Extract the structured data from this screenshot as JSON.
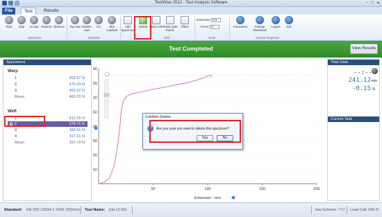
{
  "window": {
    "title": "TestWise 2012 - Test Analysis Software",
    "controls": [
      "–",
      "□",
      "✕"
    ]
  },
  "ribbon": {
    "tabs": [
      "File",
      "Test",
      "Results"
    ],
    "buttons": {
      "start": "Start",
      "stop": "Stop",
      "accept": "Accept",
      "restore": "Restore",
      "observe": "Observe",
      "top_jaw": "Top Jaw",
      "bottom_jaw": "Bottom Jaw",
      "go": "Go",
      "tare_loadcell": "Tare Loadcell",
      "add_specimen": "Add Specimen",
      "delete": "Delete",
      "select_all": "Select All+",
      "show_data_points": "Show Data Points",
      "offset": "Offset",
      "favourites": "Favourites",
      "change_password": "Change Password",
      "logout": "Logout",
      "exit": "Exit"
    },
    "fields": {
      "extension_label": "Extension",
      "extension_unit": "mm",
      "force_label": "Force",
      "force_unit": "N"
    },
    "groups": {
      "specimen": "Specimen",
      "machine": "Machine",
      "edit": "Edit",
      "units": "Units",
      "service_engineer": "Service Engineer"
    }
  },
  "banner": {
    "message": "Test Completed",
    "view_results": "View Results"
  },
  "specimens": {
    "header": "Specimens",
    "warp": {
      "label": "Warp",
      "rows": [
        {
          "n": "1",
          "v": "452.57 N"
        },
        {
          "n": "2",
          "v": "472.33 N"
        },
        {
          "n": "3",
          "v": "463.22 N"
        }
      ],
      "mean": {
        "n": "Mean",
        "v": "462.70 N"
      }
    },
    "weft": {
      "label": "Weft",
      "rows": [
        {
          "n": "1",
          "v": "412.25 N"
        },
        {
          "n": "2",
          "v": "378.71 N"
        },
        {
          "n": "3",
          "v": "382.51 N"
        },
        {
          "n": "4",
          "v": "417.31 N"
        }
      ],
      "mean": {
        "n": "Mean",
        "v": "397.70 N"
      }
    }
  },
  "chart_data": {
    "type": "line",
    "xlabel": "Extension - mm",
    "ylabel": "Force - N",
    "xlim": [
      0,
      200
    ],
    "ylim": [
      0,
      400
    ],
    "xticks": [
      50,
      100,
      150,
      200
    ],
    "yticks": [
      50,
      100,
      150,
      200,
      250,
      300,
      350,
      400
    ],
    "series": [
      {
        "x": [
          0,
          5,
          10,
          14,
          17,
          19,
          20,
          21,
          23,
          26,
          30,
          35,
          40,
          50,
          60,
          70,
          80,
          90,
          95,
          100,
          103,
          104
        ],
        "y": [
          0,
          5,
          20,
          60,
          120,
          180,
          220,
          260,
          290,
          305,
          312,
          316,
          320,
          328,
          335,
          343,
          350,
          360,
          366,
          374,
          378,
          370
        ]
      }
    ],
    "reference_line_y": 378
  },
  "titan_data": {
    "header": "Titan Data",
    "time": "--:--",
    "extension": "241.12",
    "extension_unit": "mm",
    "force": "-0.15",
    "force_unit": "N",
    "current_task": "Current Task"
  },
  "dialog": {
    "title": "Confirm Delete",
    "message": "Are you sure you want to delete this specimen?",
    "yes": "Yes",
    "no": "No"
  },
  "status": {
    "standard_label": "Standard:",
    "standard_value": "EN ISO 13934-1:1999 (200mm)",
    "test_name_label": "Test Name:",
    "test_name_value": "Job 12.051",
    "jaw_scheme": "Jaw Scheme: 717",
    "load_cell": "Load Cell: 600 N"
  },
  "colors": {
    "banner": "#3a9a33",
    "accent_blue": "#2e77c8",
    "selected_row": "#6a5ba8",
    "curve": "#c468c8",
    "highlight": "#d9262b"
  }
}
